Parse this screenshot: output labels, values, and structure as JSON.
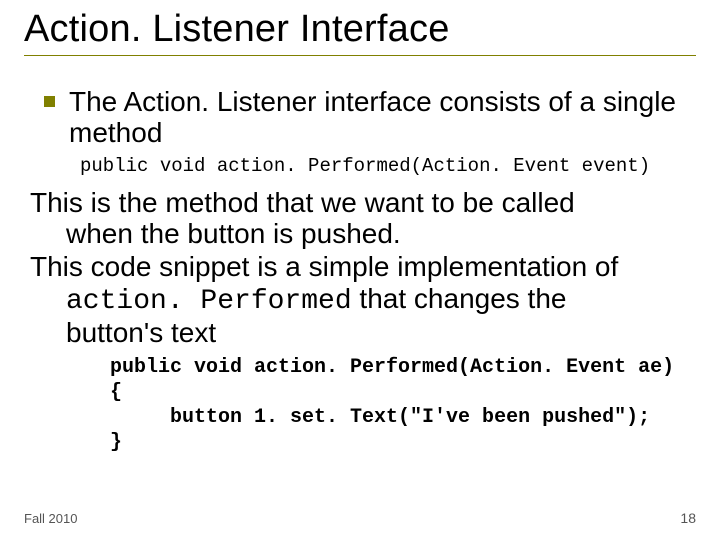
{
  "slide": {
    "title": "Action. Listener Interface",
    "bullet1": "The Action. Listener interface consists of a single method",
    "code1": "public void action. Performed(Action. Event event)",
    "para1_line1": "This is the method that we want to be called",
    "para1_line2": "when the button is pushed.",
    "para2_line1": "This code snippet is a simple implementation of",
    "para2_inline_code": "action. Performed",
    "para2_line2_rest": " that changes the",
    "para2_line3": "button's text",
    "code2_l1": "public void action. Performed(Action. Event ae)",
    "code2_l2": "{",
    "code2_l3": "     button 1. set. Text(\"I've been pushed\");",
    "code2_l4": "}",
    "footer_left": "Fall 2010",
    "footer_right": "18"
  }
}
